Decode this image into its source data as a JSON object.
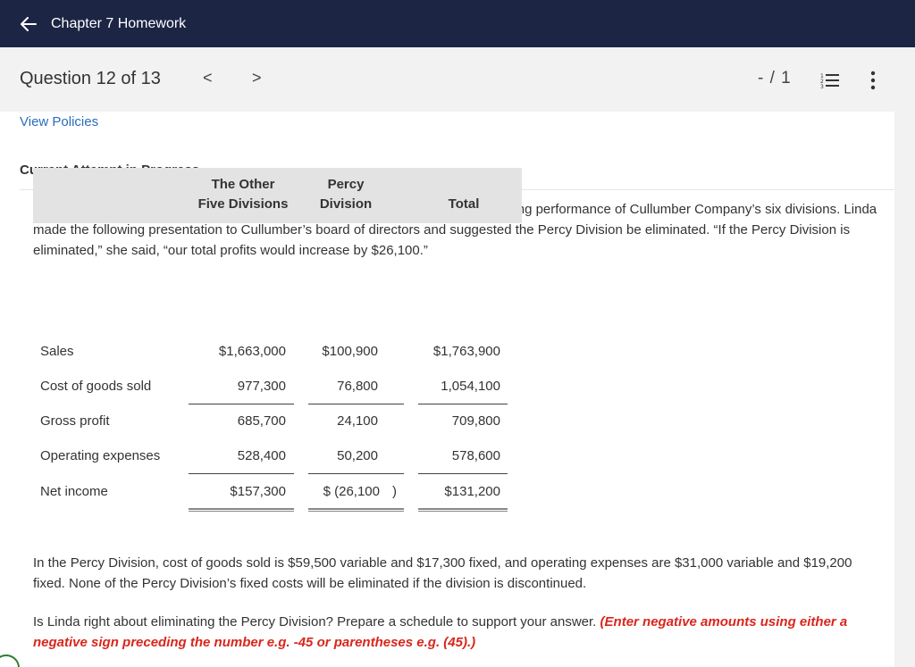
{
  "header": {
    "title": "Chapter 7 Homework",
    "back_icon": "arrow-left-icon"
  },
  "question_bar": {
    "label": "Question 12 of 13",
    "prev": "<",
    "next": ">",
    "score": "- / 1"
  },
  "policies_link": "View Policies",
  "attempt_label": "Current Attempt in Progress",
  "intro": "Linda Mars, a recent graduate of Bell’s accounting program, evaluated the operating performance of Cullumber Company’s six divisions. Linda made the following presentation to Cullumber’s board of directors and suggested the Percy Division be eliminated. “If the Percy Division is eliminated,” she said, “our total profits would increase by $26,100.”",
  "table": {
    "headers": {
      "col1_line1": "The Other",
      "col1_line2": "Five Divisions",
      "col2_line1": "Percy",
      "col2_line2": "Division",
      "col3": "Total"
    },
    "rows": [
      {
        "label": "Sales",
        "c1": "$1,663,000",
        "c2": "$100,900",
        "c3": "$1,763,900"
      },
      {
        "label": "Cost of goods sold",
        "c1": "977,300",
        "c2": "76,800",
        "c3": "1,054,100"
      },
      {
        "label": "Gross profit",
        "c1": "685,700",
        "c2": "24,100",
        "c3": "709,800"
      },
      {
        "label": "Operating expenses",
        "c1": "528,400",
        "c2": "50,200",
        "c3": "578,600"
      },
      {
        "label": "Net income",
        "c1": "$157,300",
        "c2": "$ (26,100",
        "c2_close": ")",
        "c3": "$131,200"
      }
    ]
  },
  "para2": "In the Percy Division, cost of goods sold is $59,500 variable and $17,300 fixed, and operating expenses are $31,000 variable and $19,200 fixed. None of the Percy Division’s fixed costs will be eliminated if the division is discontinued.",
  "para3_text": "Is Linda right about eliminating the Percy Division? Prepare a schedule to support your answer.",
  "para3_instruction": "(Enter negative amounts using either a negative sign preceding the number e.g. -45 or parentheses e.g. (45).)",
  "colors": {
    "topbar": "#1c2544",
    "link": "#2a6ebb",
    "instruction": "#d9261c"
  }
}
